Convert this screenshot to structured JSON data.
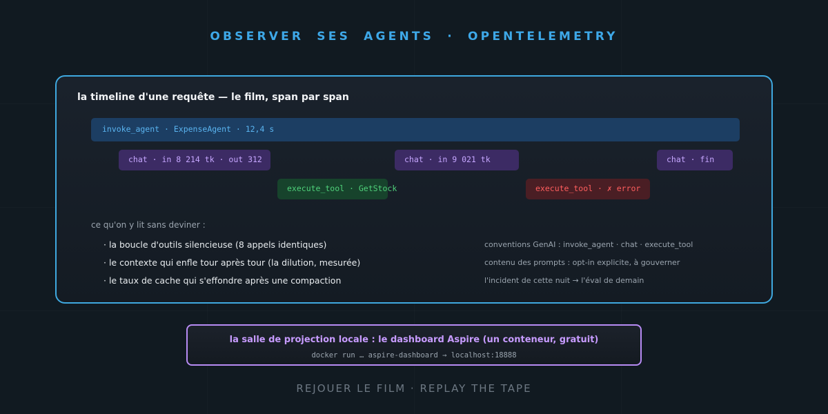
{
  "page_title": "OBSERVER SES AGENTS · OPENTELEMETRY",
  "card": {
    "heading": "la timeline d'une requête — le film, span par span",
    "spans": {
      "root": "invoke_agent · ExpenseAgent · 12,4 s",
      "chat_1": "chat · in 8 214 tk · out 312",
      "chat_2": "chat · in 9 021 tk",
      "chat_3": "chat · fin",
      "tool_ok": "execute_tool · GetStock",
      "tool_err": "execute_tool · ✗ error"
    },
    "findings_intro": "ce qu'on y lit sans deviner :",
    "findings": [
      "· la boucle d'outils silencieuse (8 appels identiques)",
      "· le contexte qui enfle tour après tour (la dilution, mesurée)",
      "· le taux de cache qui s'effondre après une compaction"
    ],
    "notes": [
      "conventions GenAI : invoke_agent · chat · execute_tool",
      "contenu des prompts : opt-in explicite, à gouverner",
      "l'incident de cette nuit → l'éval de demain"
    ]
  },
  "dashboard": {
    "title": "la salle de projection locale : le dashboard Aspire (un conteneur, gratuit)",
    "command": "docker run … aspire-dashboard → localhost:18888"
  },
  "footer": "REJOUER LE FILM · REPLAY THE TAPE",
  "colors": {
    "accent_blue": "#3fa9e0",
    "root_span": "#1c3e63",
    "chat_span": "#3c2b64",
    "tool_ok": "#17432c",
    "tool_error": "#4a1e24",
    "dashboard_border": "#b88cf5"
  }
}
